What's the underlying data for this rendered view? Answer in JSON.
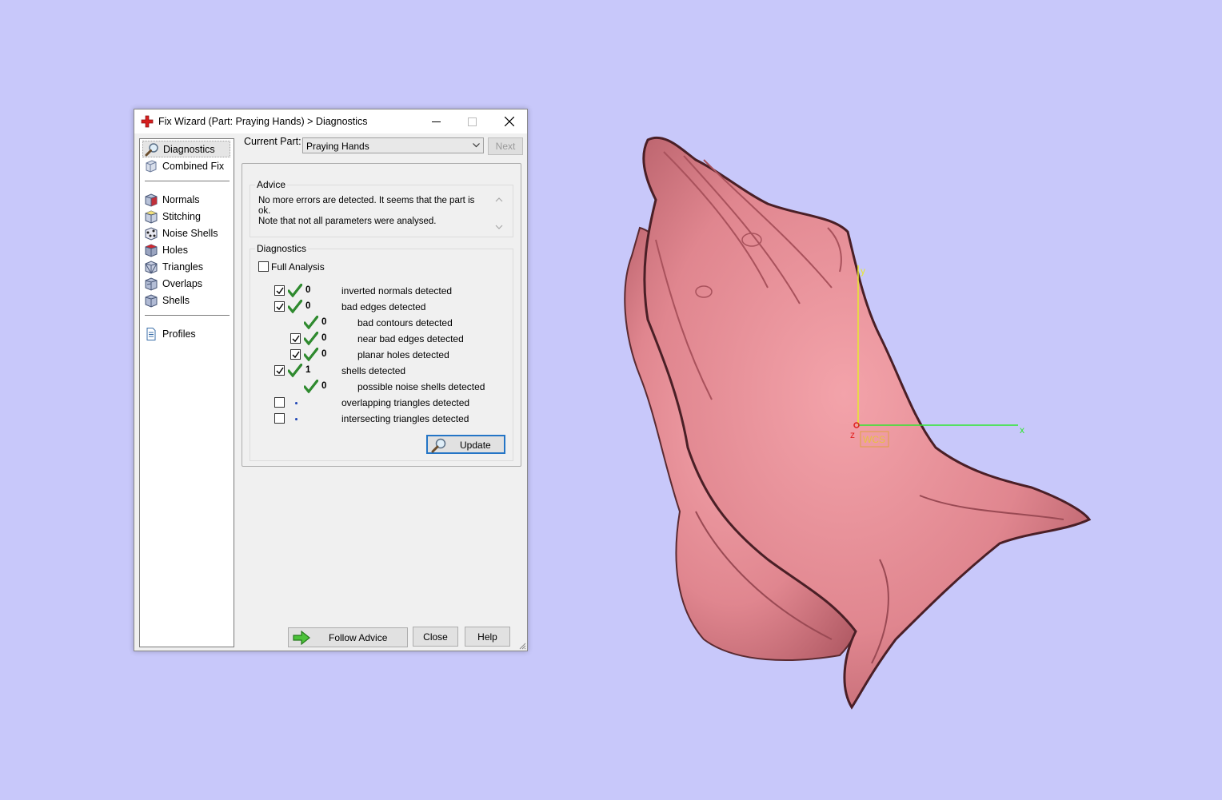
{
  "window": {
    "title": "Fix Wizard (Part: Praying Hands) > Diagnostics",
    "minimize_label": "",
    "maximize_label": "",
    "close_label": ""
  },
  "nav": {
    "items": [
      {
        "label": "Diagnostics",
        "icon": "magnifier-icon",
        "selected": true
      },
      {
        "label": "Combined Fix",
        "icon": "cube-icon"
      },
      {
        "label": "Normals",
        "icon": "normals-cube-icon"
      },
      {
        "label": "Stitching",
        "icon": "stitching-cube-icon"
      },
      {
        "label": "Noise Shells",
        "icon": "noise-shells-icon"
      },
      {
        "label": "Holes",
        "icon": "holes-cube-icon"
      },
      {
        "label": "Triangles",
        "icon": "triangles-cube-icon"
      },
      {
        "label": "Overlaps",
        "icon": "overlaps-cube-icon"
      },
      {
        "label": "Shells",
        "icon": "shells-cube-icon"
      },
      {
        "label": "Profiles",
        "icon": "document-icon"
      }
    ]
  },
  "main": {
    "current_part_label": "Current Part:",
    "current_part_value": "Praying Hands",
    "next_label": "Next",
    "advice": {
      "title": "Advice",
      "line1": "No more errors are detected. It seems that the part is ok.",
      "line2": "Note that not all parameters were analysed."
    },
    "diagnostics": {
      "title": "Diagnostics",
      "full_analysis_label": "Full Analysis",
      "full_analysis_checked": false,
      "rows": [
        {
          "checked": true,
          "status": "ok",
          "count": "0",
          "label": "inverted normals detected"
        },
        {
          "checked": true,
          "status": "ok",
          "count": "0",
          "label": "bad edges detected"
        },
        {
          "checked": null,
          "status": "ok",
          "count": "0",
          "label": "bad contours detected"
        },
        {
          "checked": true,
          "status": "ok",
          "count": "0",
          "label": "near bad edges detected"
        },
        {
          "checked": true,
          "status": "ok",
          "count": "0",
          "label": "planar holes detected"
        },
        {
          "checked": true,
          "status": "ok",
          "count": "1",
          "label": "shells detected"
        },
        {
          "checked": null,
          "status": "ok",
          "count": "0",
          "label": "possible noise shells detected"
        },
        {
          "checked": false,
          "status": "none",
          "count": "",
          "label": "overlapping triangles detected"
        },
        {
          "checked": false,
          "status": "none",
          "count": "",
          "label": "intersecting triangles detected"
        }
      ],
      "update_label": "Update"
    },
    "follow_advice_label": "Follow Advice",
    "close_label": "Close",
    "help_label": "Help"
  },
  "viewport": {
    "background": "#c8c8fa",
    "model_color": "#e58a92",
    "axis_x_label": "x",
    "axis_y_label": "y",
    "axis_z_label": "z",
    "wcs_label": "WCS",
    "axis_x_color": "#2ee82e",
    "axis_y_color": "#e8e82e",
    "axis_z_color": "#e02020"
  }
}
